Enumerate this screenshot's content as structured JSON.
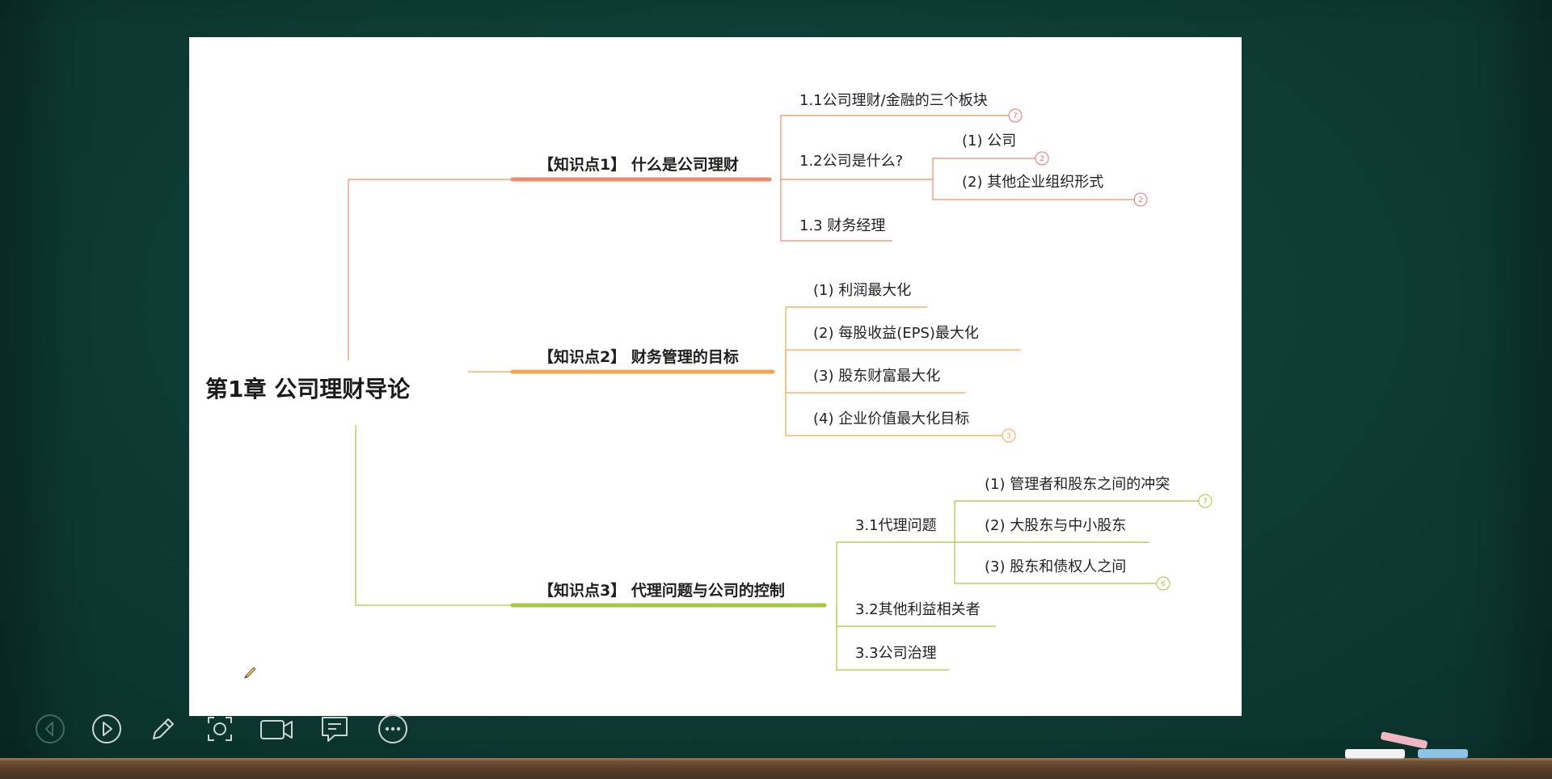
{
  "mindmap": {
    "root": "第1章  公司理财导论",
    "kp1": {
      "title": "【知识点1】 什么是公司理财",
      "c11": "1.1公司理财/金融的三个板块",
      "c11_badge": "7",
      "c12": "1.2公司是什么?",
      "c12a": "(1) 公司",
      "c12a_badge": "2",
      "c12b": "(2) 其他企业组织形式",
      "c12b_badge": "2",
      "c13": "1.3 财务经理"
    },
    "kp2": {
      "title": "【知识点2】 财务管理的目标",
      "c1": "(1) 利润最大化",
      "c2": "(2) 每股收益(EPS)最大化",
      "c3": "(3) 股东财富最大化",
      "c4": "(4) 企业价值最大化目标",
      "c4_badge": "3"
    },
    "kp3": {
      "title": "【知识点3】 代理问题与公司的控制",
      "c31": "3.1代理问题",
      "c31a": "(1) 管理者和股东之间的冲突",
      "c31a_badge": "7",
      "c31b": "(2) 大股东与中小股东",
      "c31c": "(3) 股东和债权人之间",
      "c31c_badge": "6",
      "c32": "3.2其他利益相关者",
      "c33": "3.3公司治理"
    }
  },
  "colors": {
    "board": "#0f3d36",
    "kp1": "#ef8a6b",
    "kp2": "#f5a552",
    "kp3": "#a5c840",
    "badge": "#e57373"
  },
  "toolbar": {
    "icons": [
      "back-icon",
      "play-icon",
      "pen-icon",
      "screenshot-icon",
      "camera-icon",
      "comment-icon",
      "more-icon"
    ]
  }
}
